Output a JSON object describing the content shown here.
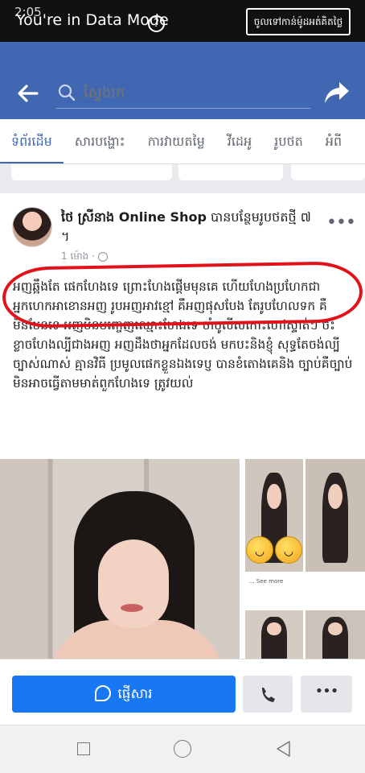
{
  "status_bar": {
    "time": "2:05",
    "mode_text": "You're in Data Mode",
    "help_glyph": "?",
    "data_button_label": "ចូលទៅកាន់ម៉ូដអត់គិតថ្លៃ"
  },
  "header": {
    "search_placeholder": "ស្វែងរក"
  },
  "tabs": [
    "ទំព័រដើម",
    "សារបង្ហោះ",
    "ការវាយតម្លៃ",
    "វីដេអូ",
    "រូបថត",
    "អំពី"
  ],
  "post": {
    "author_name": "ថៃ ស្រីនាង Online Shop",
    "author_action": " បានបន្ថែមរូបថតថ្មី ៧ ។",
    "time": "1 ម៉ោង ·",
    "more_label": "•••",
    "body": "អញឆ្អឹងតែ ផេកហែងទេ ព្រោះហែងផ្តើមមុនគេ ហើយហែងប្រហែកជាអ្នកហេកអាខោនអញ រូបអញអាវខ្មៅ គឺអញផុសបែង តែរូបហែលទក គឺមិនមែនទេ អញមិនបញ្ចេញឈ្មោះហែងទេ ចាំបូលីសកោះហៅស្ទាត់ៗ ចះ ខ្លាចហែងល្បីជាងអញ អញដឹងថាអ្នកដែលចង់ មកបះនិងខ្ញុំ សុទ្ធតែចង់ល្បីច្បាស់ណាស់ គ្មានវិធី ប្រមូលផេកខ្លួនឯងទេប្ញ បានខំតោងគេនិង ច្បាប់គឺច្បាប់ មិនអាចធ្វើតាមមាត់ពួកហែងទេ ត្រូវយល់",
    "message_preview": "... See more"
  },
  "actions": {
    "send_message_label": "ផ្ញើសារ",
    "more_label": "•••"
  },
  "colors": {
    "facebook_blue": "#4267b2",
    "messenger_blue": "#1877f2",
    "annotation_red": "#e2121a"
  },
  "icons": [
    "back-arrow-icon",
    "search-icon",
    "share-icon",
    "globe-icon",
    "messenger-icon",
    "phone-icon",
    "nav-square-icon",
    "nav-circle-icon",
    "nav-back-icon"
  ]
}
